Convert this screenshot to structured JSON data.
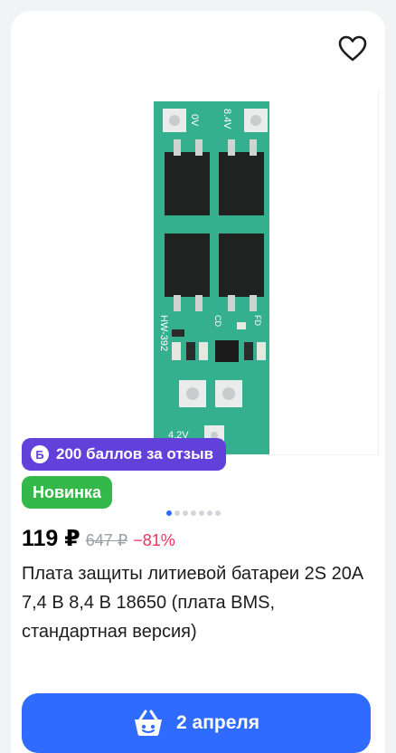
{
  "product": {
    "points_badge": "200 баллов за отзыв",
    "points_icon_letter": "Б",
    "new_badge": "Новинка",
    "price_current": "119 ₽",
    "price_old": "647 ₽",
    "discount": "−81%",
    "title": "Плата защиты литиевой батареи 2S 20A 7,4 В 8,4 В 18650 (плата BMS, стандартная версия)",
    "image_carousel": {
      "total": 7,
      "active_index": 0
    },
    "board_labels": {
      "top_left": "0V",
      "top_right": "8.4V",
      "side": "HW-392",
      "bottom": "4.2V",
      "cd": "CD",
      "fd": "FD"
    }
  },
  "actions": {
    "cart_button_label": "2 апреля",
    "favorite_icon": "heart-outline-icon",
    "cart_icon": "basket-icon"
  },
  "colors": {
    "points_badge": "#6141d9",
    "new_badge": "#35b84a",
    "discount": "#f0325a",
    "cart_button": "#2f6bff",
    "pcb": "#2fae8e"
  }
}
